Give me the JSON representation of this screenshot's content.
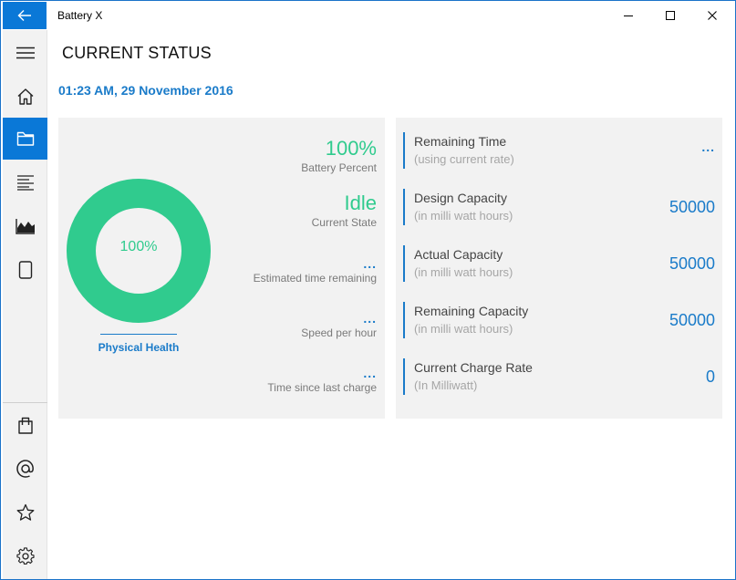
{
  "app": {
    "title": "Battery X"
  },
  "page": {
    "title": "CURRENT STATUS",
    "datetime": "01:23 AM, 29 November 2016"
  },
  "colors": {
    "accent": "#0a78d7",
    "link": "#1a7bc9",
    "green": "#30cb8e"
  },
  "sidebar": {
    "items": [
      {
        "icon": "hamburger-icon"
      },
      {
        "icon": "home-icon"
      },
      {
        "icon": "folder-icon",
        "active": true
      },
      {
        "icon": "list-icon"
      },
      {
        "icon": "area-chart-icon"
      },
      {
        "icon": "tablet-icon"
      },
      {
        "icon": "shopping-bag-icon"
      },
      {
        "icon": "at-sign-icon"
      },
      {
        "icon": "star-icon"
      },
      {
        "icon": "gear-icon"
      }
    ]
  },
  "health": {
    "percent_text": "100%",
    "fill_fraction": 1.0,
    "label": "Physical Health"
  },
  "stats": {
    "battery_percent": {
      "value": "100%",
      "label": "Battery Percent"
    },
    "current_state": {
      "value": "Idle",
      "label": "Current State"
    },
    "time_remaining": {
      "value": "...",
      "label": "Estimated time remaining"
    },
    "speed": {
      "value": "...",
      "label": "Speed per hour"
    },
    "since_charge": {
      "value": "...",
      "label": "Time since last charge"
    }
  },
  "metrics": [
    {
      "name": "Remaining Time",
      "sub": "(using current rate)",
      "value": "..."
    },
    {
      "name": "Design Capacity",
      "sub": "(in milli watt hours)",
      "value": "50000"
    },
    {
      "name": "Actual Capacity",
      "sub": "(in milli watt hours)",
      "value": "50000"
    },
    {
      "name": "Remaining Capacity",
      "sub": "(in milli watt hours)",
      "value": "50000"
    },
    {
      "name": "Current Charge Rate",
      "sub": "(In Milliwatt)",
      "value": "0"
    }
  ]
}
